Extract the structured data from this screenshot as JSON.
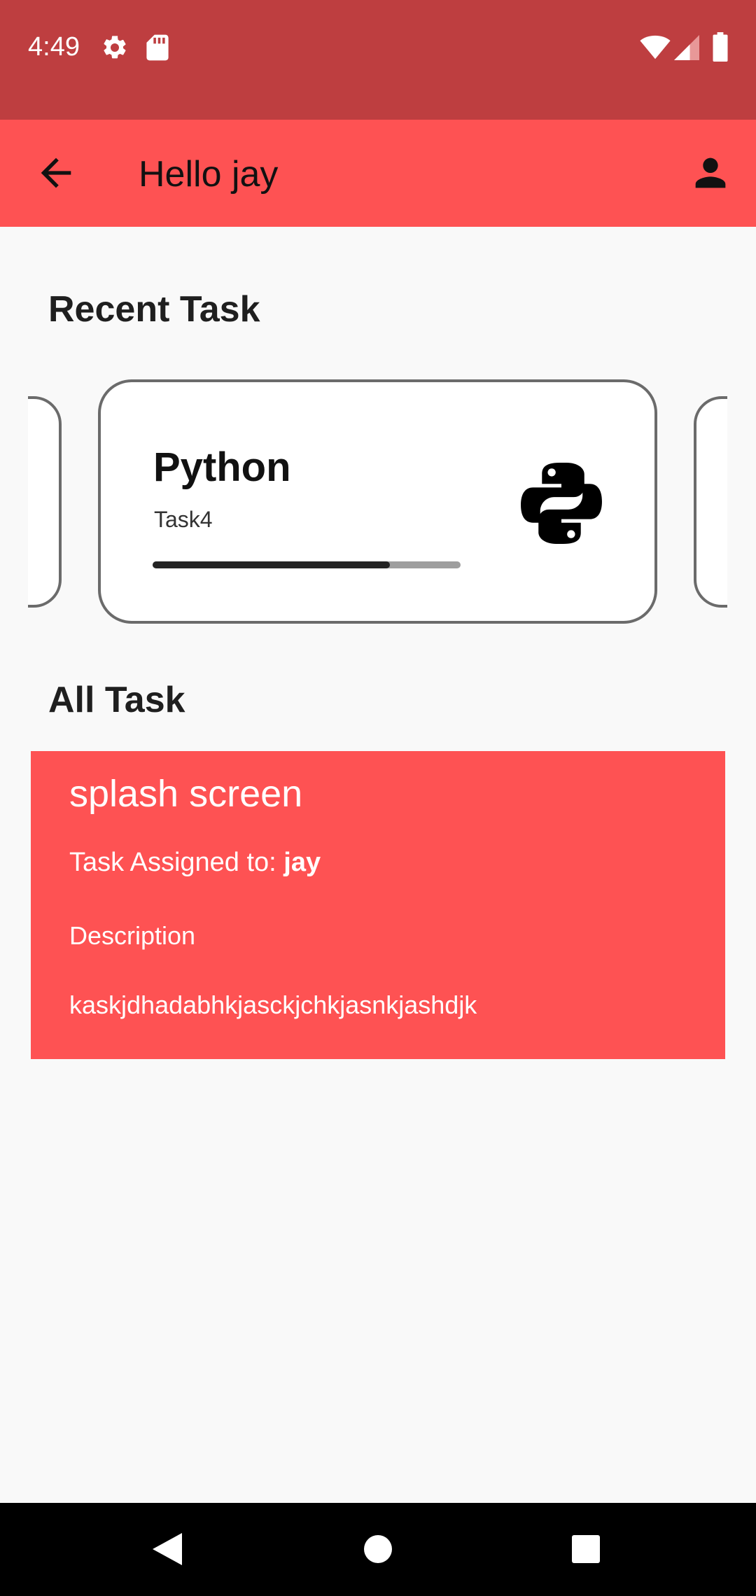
{
  "status_bar": {
    "time": "4:49",
    "left_icons": [
      "gear-icon",
      "sd-card-icon"
    ],
    "right_icons": [
      "wifi-icon",
      "signal-icon",
      "battery-icon"
    ]
  },
  "app_bar": {
    "title": "Hello jay",
    "back_icon": "arrow-back-icon",
    "profile_icon": "person-icon",
    "color": "#fe5253"
  },
  "recent_section": {
    "title": "Recent Task",
    "card": {
      "title": "Python",
      "subtitle": "Task4",
      "progress": 0.77,
      "icon": "python-logo-icon"
    }
  },
  "all_section": {
    "title": "All Task",
    "task": {
      "title": "splash screen",
      "assigned_prefix": "Task Assigned to: ",
      "assignee": "jay",
      "description_label": "Description",
      "description": "kaskjdhadabhkjasckjchkjasnkjashdjk"
    }
  },
  "nav_bar": {
    "icons": [
      "back-triangle-icon",
      "home-circle-icon",
      "recents-square-icon"
    ]
  }
}
